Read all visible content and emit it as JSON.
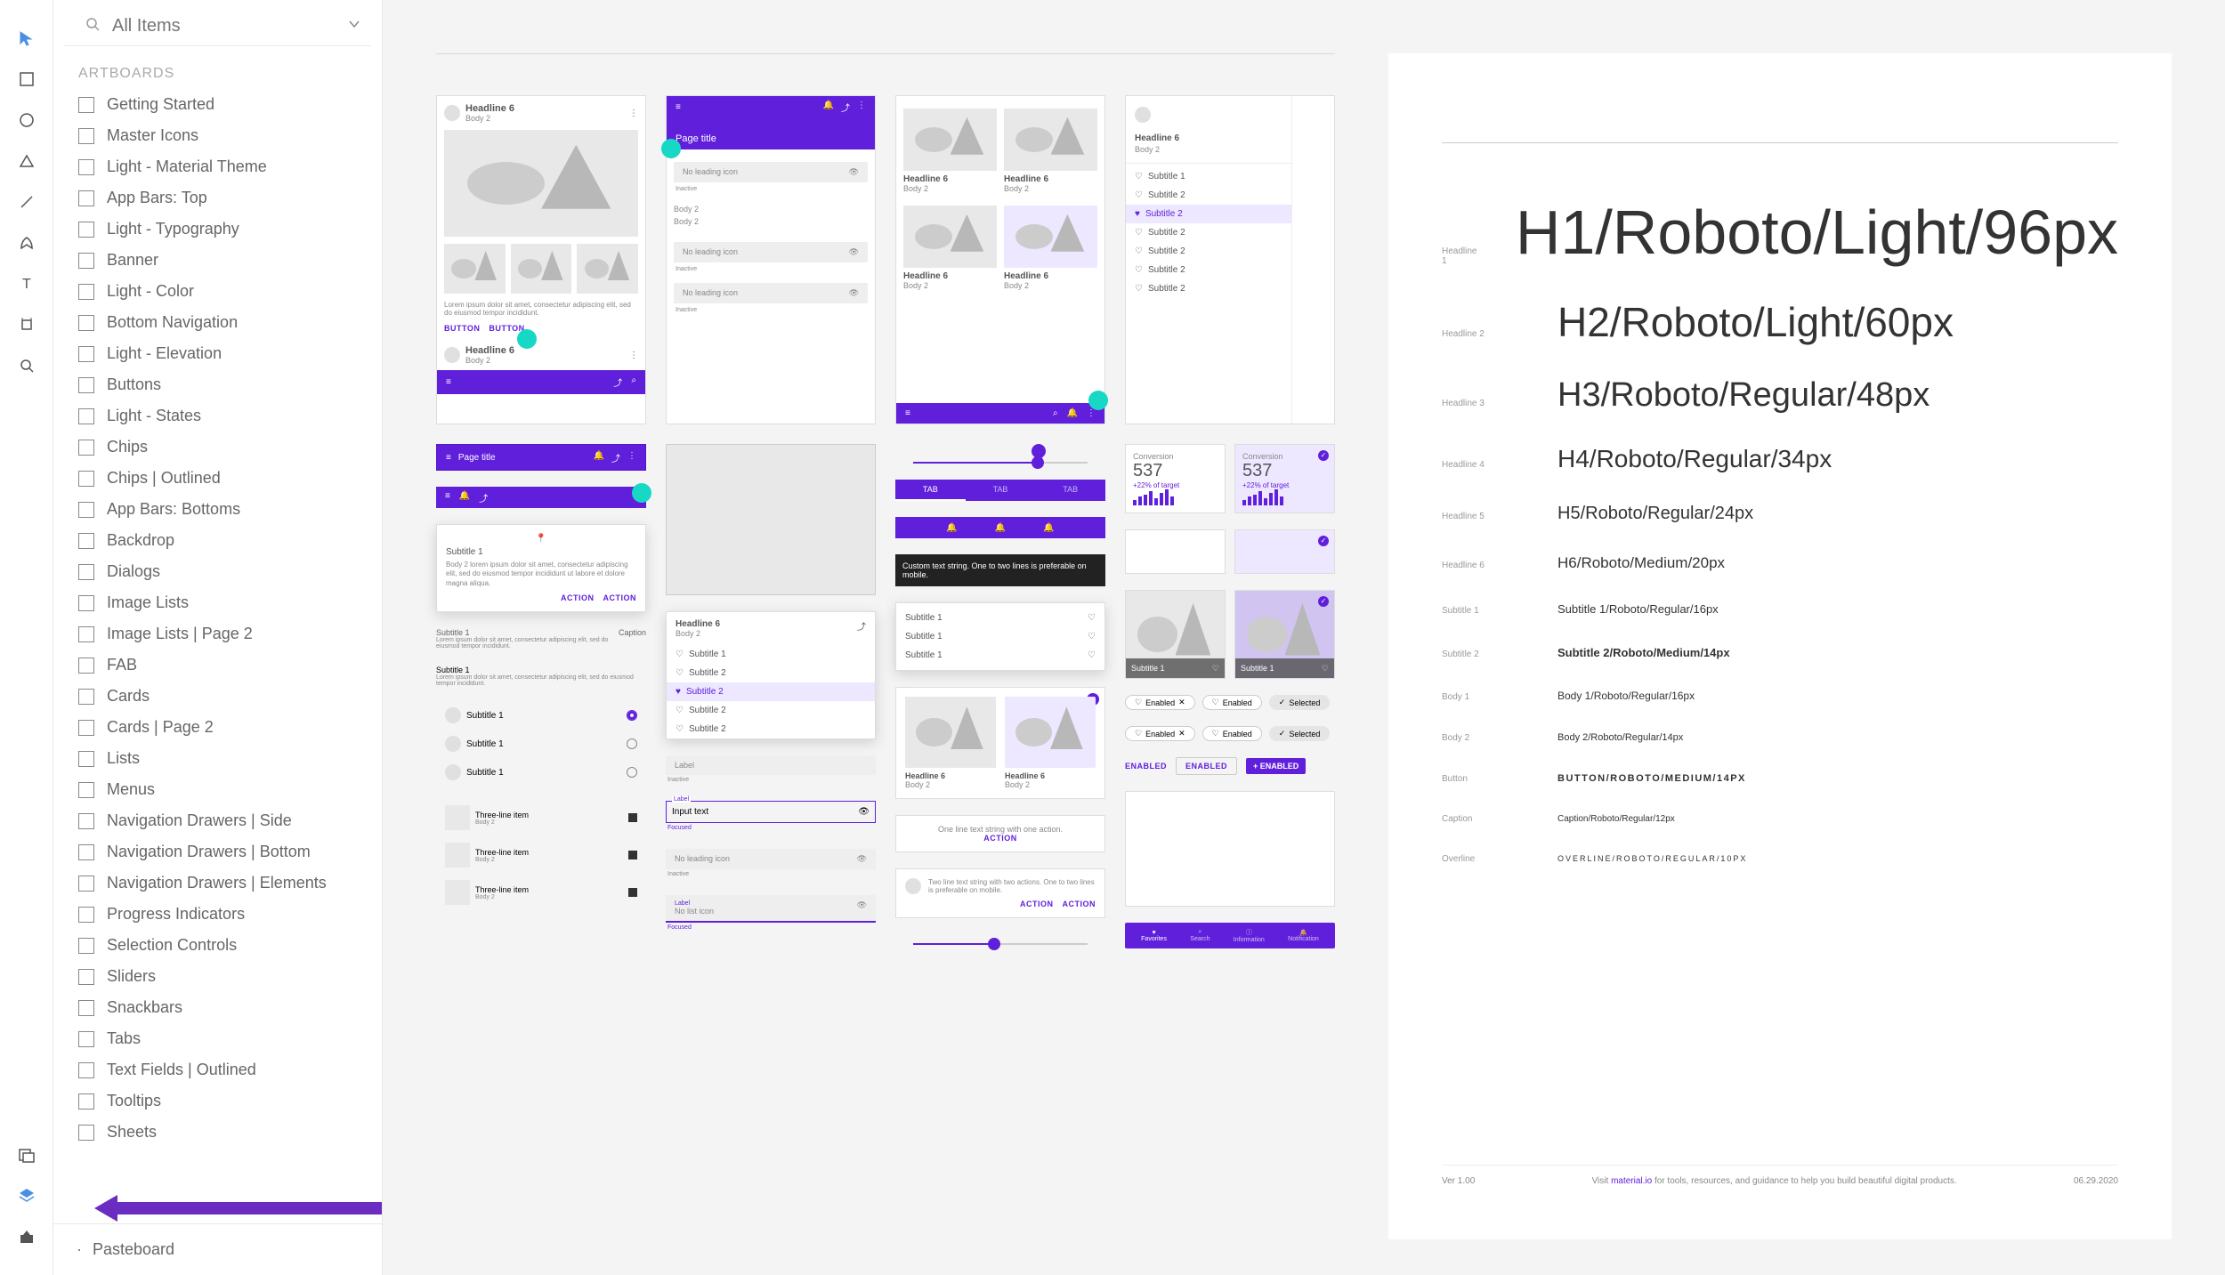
{
  "search": {
    "placeholder": "All Items"
  },
  "section": "ARTBOARDS",
  "artboards": [
    "Getting Started",
    "Master Icons",
    "Light - Material Theme",
    "App Bars: Top",
    "Light - Typography",
    "Banner",
    "Light - Color",
    "Bottom Navigation",
    "Light - Elevation",
    "Buttons",
    "Light - States",
    "Chips",
    "Chips | Outlined",
    "App Bars: Bottoms",
    "Backdrop",
    "Dialogs",
    "Image Lists",
    "Image Lists | Page 2",
    "FAB",
    "Cards",
    "Cards | Page 2",
    "Lists",
    "Menus",
    "Navigation Drawers | Side",
    "Navigation Drawers | Bottom",
    "Navigation Drawers | Elements",
    "Progress Indicators",
    "Selection Controls",
    "Sliders",
    "Snackbars",
    "Tabs",
    "Text Fields | Outlined",
    "Tooltips",
    "Sheets"
  ],
  "pasteboard": "Pasteboard",
  "sample": {
    "headline": "Headline 6",
    "body": "Body 2",
    "pageTitle": "Page title",
    "noLeadingIcon": "No leading icon",
    "inactive": "Inactive",
    "focused": "Focused",
    "subtitle1": "Subtitle 1",
    "subtitle2": "Subtitle 2",
    "action": "ACTION",
    "button": "BUTTON",
    "caption": "Caption",
    "lorem": "Lorem ipsum dolor sit amet, consectetur adipiscing elit, sed do eiusmod tempor incididunt.",
    "label": "Label",
    "inputText": "Input text",
    "threeLine": "Three-line item",
    "tab": "TAB",
    "oneLineAction": "One line text string with one action.",
    "twoLineAction": "Two line text string with two actions. One to two lines is preferable on mobile.",
    "snackbar": "Custom text string. One to two lines is preferable on mobile.",
    "enabled": "Enabled",
    "enabledCaps": "ENABLED",
    "selected": "Selected",
    "conversion": "Conversion",
    "metricValue": "537",
    "metricDelta": "+22% of target",
    "favorites": "Favorites",
    "search": "Search",
    "information": "Information",
    "notification": "Notification",
    "bodyLorem": "Body 2 lorem ipsum dolor sit amet, consectetur adipiscing elit, sed do eiusmod tempor incididunt ut labore et dolore magna aliqua.",
    "noListIcon": "No list icon"
  },
  "typo": {
    "h1": {
      "label": "Headline 1",
      "sample": "H1/Roboto/Light/96px"
    },
    "h2": {
      "label": "Headline 2",
      "sample": "H2/Roboto/Light/60px"
    },
    "h3": {
      "label": "Headline 3",
      "sample": "H3/Roboto/Regular/48px"
    },
    "h4": {
      "label": "Headline 4",
      "sample": "H4/Roboto/Regular/34px"
    },
    "h5": {
      "label": "Headline 5",
      "sample": "H5/Roboto/Regular/24px"
    },
    "h6": {
      "label": "Headline 6",
      "sample": "H6/Roboto/Medium/20px"
    },
    "s1": {
      "label": "Subtitle 1",
      "sample": "Subtitle 1/Roboto/Regular/16px"
    },
    "s2": {
      "label": "Subtitle 2",
      "sample": "Subtitle 2/Roboto/Medium/14px"
    },
    "b1": {
      "label": "Body 1",
      "sample": "Body 1/Roboto/Regular/16px"
    },
    "b2": {
      "label": "Body 2",
      "sample": "Body 2/Roboto/Regular/14px"
    },
    "btn": {
      "label": "Button",
      "sample": "BUTTON/ROBOTO/MEDIUM/14PX"
    },
    "cap": {
      "label": "Caption",
      "sample": "Caption/Roboto/Regular/12px"
    },
    "ov": {
      "label": "Overline",
      "sample": "OVERLINE/ROBOTO/REGULAR/10PX"
    }
  },
  "footer": {
    "ver": "Ver 1.00",
    "visit": "Visit ",
    "link": "material.io",
    "rest": " for tools, resources, and guidance to help you build beautiful digital products.",
    "date": "06.29.2020"
  }
}
